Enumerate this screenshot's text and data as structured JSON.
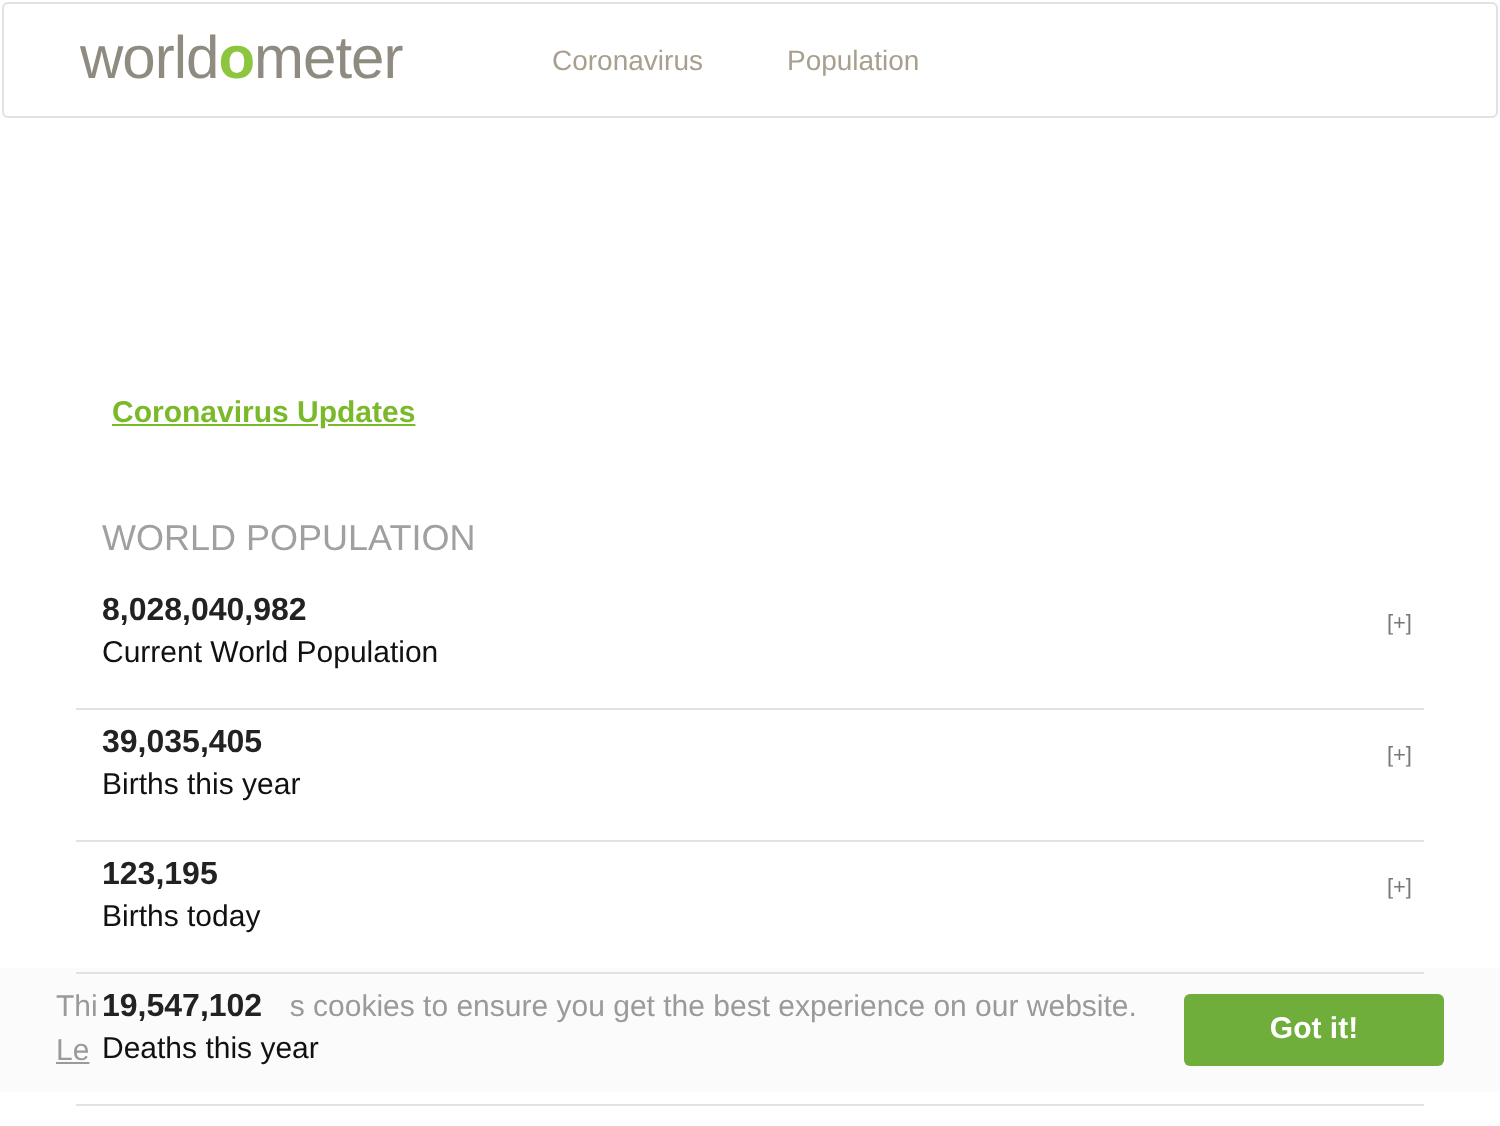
{
  "header": {
    "logo": {
      "before": "world",
      "accent": "o",
      "after": "meter"
    },
    "nav": [
      {
        "label": "Coronavirus"
      },
      {
        "label": "Population"
      }
    ]
  },
  "updates_link": "Coronavirus Updates",
  "section_title": "WORLD POPULATION",
  "counters": [
    {
      "value": "8,028,040,982",
      "label": "Current World Population",
      "toggle": "[+]"
    },
    {
      "value": "39,035,405",
      "label": "Births this year",
      "toggle": "[+]"
    },
    {
      "value": "123,195",
      "label": "Births today",
      "toggle": "[+]"
    },
    {
      "value": "19,547,102",
      "label": "Deaths this year"
    }
  ],
  "cookie_banner": {
    "message_start": "Thi",
    "message_end": "s cookies to ensure you get the best experience on our website.",
    "link": "Le",
    "button": "Got it!"
  }
}
